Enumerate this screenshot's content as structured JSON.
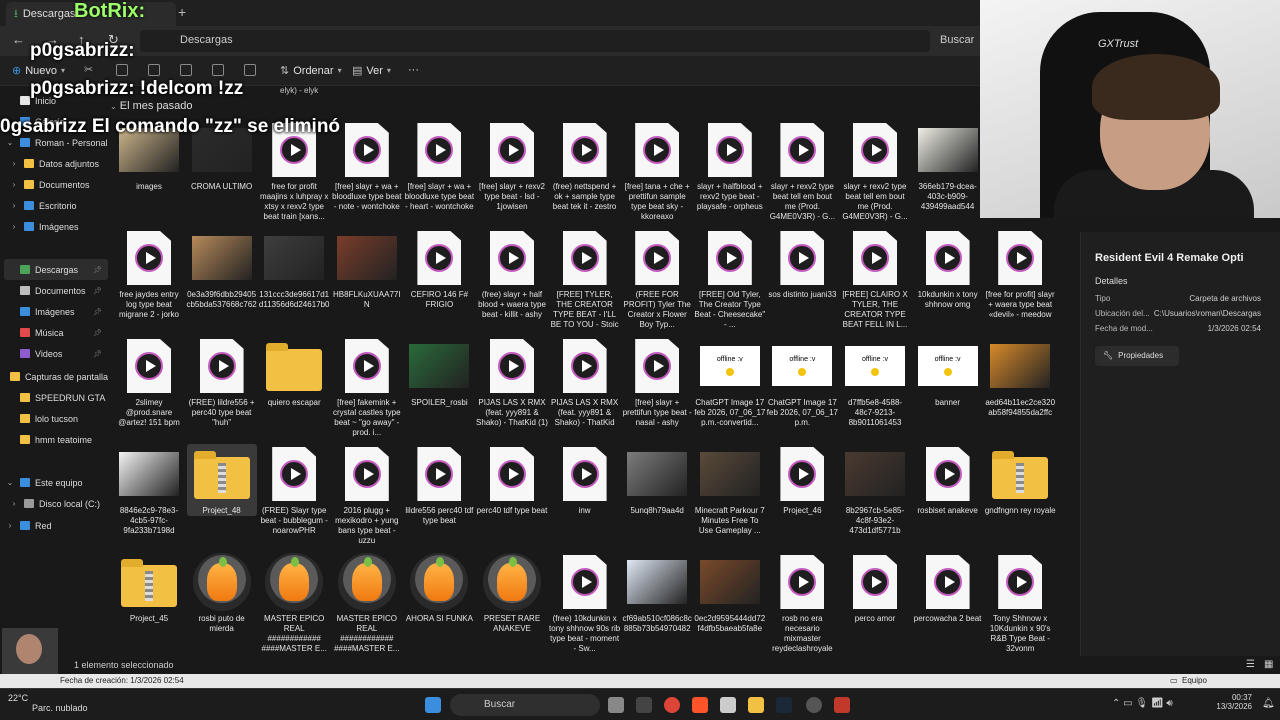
{
  "window": {
    "tab_label": "Descargas",
    "address_label": "Descargas",
    "search_label": "Buscar"
  },
  "toolbar": {
    "new_label": "Nuevo",
    "sort_label": "Ordenar",
    "view_label": "Ver",
    "more_label": "···"
  },
  "sidebar": {
    "items": [
      {
        "label": "Inicio",
        "icon": "home-icon",
        "color": "#e6e6e6"
      },
      {
        "label": "Galería",
        "icon": "gallery-icon",
        "color": "#3b8ede"
      },
      {
        "label": "Roman - Personal",
        "icon": "cloud-icon",
        "color": "#3b8ede"
      },
      {
        "label": "Datos adjuntos",
        "icon": "folder-icon",
        "color": "#f2c144"
      },
      {
        "label": "Documentos",
        "icon": "folder-icon",
        "color": "#f2c144"
      },
      {
        "label": "Escritorio",
        "icon": "folder-icon",
        "color": "#3b8ede"
      },
      {
        "label": "Imágenes",
        "icon": "folder-icon",
        "color": "#3b8ede"
      },
      {
        "label": "Descargas",
        "icon": "download-icon",
        "color": "#4ca35a"
      },
      {
        "label": "Documentos",
        "icon": "document-icon",
        "color": "#bdbdbd"
      },
      {
        "label": "Imágenes",
        "icon": "image-icon",
        "color": "#3b8ede"
      },
      {
        "label": "Música",
        "icon": "music-icon",
        "color": "#e04a4a"
      },
      {
        "label": "Videos",
        "icon": "video-icon",
        "color": "#8e5bd0"
      },
      {
        "label": "Capturas de pantalla",
        "icon": "folder-icon",
        "color": "#f2c144"
      },
      {
        "label": "SPEEDRUN GTA",
        "icon": "folder-icon",
        "color": "#f2c144"
      },
      {
        "label": "lolo tucson",
        "icon": "folder-icon",
        "color": "#f2c144"
      },
      {
        "label": "hmm teatoime",
        "icon": "folder-icon",
        "color": "#f2c144"
      },
      {
        "label": "Este equipo",
        "icon": "computer-icon",
        "color": "#3b8ede"
      },
      {
        "label": "Disco local (C:)",
        "icon": "drive-icon",
        "color": "#9a9a9a"
      },
      {
        "label": "Red",
        "icon": "network-icon",
        "color": "#3b8ede"
      }
    ]
  },
  "main": {
    "group_header": "El mes pasado",
    "partial_top_text": "elyk) - elyk",
    "rows": [
      [
        {
          "type": "image",
          "name": "images",
          "color": "#cbb48a"
        },
        {
          "type": "image",
          "name": "CROMA ULTIMO",
          "color": "#2b2b2b"
        },
        {
          "type": "audio",
          "name": "free for profit maajins x luhpray x xtsy x rexv2 type beat train [xans..."
        },
        {
          "type": "audio",
          "name": "[free] slayr + wa + bloodluxe type beat - note - wontchoke"
        },
        {
          "type": "audio",
          "name": "[free] slayr + wa + bloodluxe type beat - heart - wontchoke"
        },
        {
          "type": "audio",
          "name": "[free] slayr + rexv2 type beat - lsd - 1jowisen"
        },
        {
          "type": "audio",
          "name": "(free) nettspend + ok + sample type beat tek it - zestro"
        },
        {
          "type": "audio",
          "name": "[free] tana + che + prettifun sample type beat sky - kkoreaxo"
        },
        {
          "type": "audio",
          "name": "slayr + halfblood + rexv2 type beat - playsafe - orpheus"
        },
        {
          "type": "audio",
          "name": "slayr + rexv2 type beat tell em bout me (Prod. G4ME0V3R) - G..."
        },
        {
          "type": "audio",
          "name": "slayr + rexv2 type beat tell em bout me (Prod. G4ME0V3R) - G..."
        },
        {
          "type": "image",
          "name": "366eb179-dcea-403c-b909-439499aad544",
          "color": "#efefe6"
        }
      ],
      [
        {
          "type": "audio",
          "name": "free jaydes entry log type beat migrane 2 - jorko"
        },
        {
          "type": "image",
          "name": "0e3a39f6dbb29405cb5bda537668c762",
          "color": "#b78a5a"
        },
        {
          "type": "image",
          "name": "131ccc3de96617d1d11356d6d24617b0",
          "color": "#3e3e3e"
        },
        {
          "type": "image",
          "name": "HB8FLKuXUAA77IN",
          "color": "#7a3d2a"
        },
        {
          "type": "audio",
          "name": "CEFIRO 146 F# FRIGIO"
        },
        {
          "type": "audio",
          "name": "(free) slayr + half blood + waera type beat - killit - ashy"
        },
        {
          "type": "audio",
          "name": "[FREE] TYLER, THE CREATOR TYPE BEAT - I'LL BE TO YOU - Stoic"
        },
        {
          "type": "audio",
          "name": "(FREE FOR PROFIT) Tyler The Creator x Flower Boy Typ..."
        },
        {
          "type": "audio",
          "name": "[FREE] Old Tyler, The Creator Type Beat - Cheesecake\" - ..."
        },
        {
          "type": "audio",
          "name": "sos distinto juani33"
        },
        {
          "type": "audio",
          "name": "[FREE] CLAIRO X TYLER, THE CREATOR TYPE BEAT FELL IN L..."
        },
        {
          "type": "audio",
          "name": "10kdunkin x tony shhnow omg"
        },
        {
          "type": "audio",
          "name": "[free for profit] slayr + waera type beat «devil» - meedow"
        }
      ],
      [
        {
          "type": "audio",
          "name": "2slimey @prod.snare @artez! 151 bpm"
        },
        {
          "type": "audio",
          "name": "(FREE) lildre556 + perc40 type beat \"huh\""
        },
        {
          "type": "folder",
          "name": "quiero escapar"
        },
        {
          "type": "audio",
          "name": "[free] fakemink + crystal castles type beat ~ \"go away\" - prod. i..."
        },
        {
          "type": "image",
          "name": "SPOILER_rosbi",
          "color": "#2a6a3a"
        },
        {
          "type": "audio",
          "name": "PIJAS LAS X RMX (feat. yyy891 & Shako) - ThatKid (1)"
        },
        {
          "type": "audio",
          "name": "PIJAS LAS X RMX (feat. yyy891 & Shako) - ThatKid"
        },
        {
          "type": "audio",
          "name": "[free] slayr + prettifun type beat - nasal - ashy"
        },
        {
          "type": "offline",
          "name": "ChatGPT Image 17 feb 2026, 07_06_17 p.m.-convertid..."
        },
        {
          "type": "offline",
          "name": "ChatGPT Image 17 feb 2026, 07_06_17 p.m."
        },
        {
          "type": "offline",
          "name": "d7ffb5e8-4588-48c7-9213-8b9011061453"
        },
        {
          "type": "offline",
          "name": "banner"
        },
        {
          "type": "image",
          "name": "aed64b11ec2ce320ab58f94855da2ffc",
          "color": "#d88a2a"
        }
      ],
      [
        {
          "type": "image",
          "name": "8846e2c9-78e3-4cb5-97fc-9fa233b7198d",
          "color": "#f3f3f3"
        },
        {
          "type": "zip",
          "name": "Project_48",
          "selected": true
        },
        {
          "type": "audio",
          "name": "(FREE) Slayr type beat - bubblegum - noarowPHR"
        },
        {
          "type": "audio",
          "name": "2016 plugg + mexikodro + yung bans type beat - uzzu"
        },
        {
          "type": "audio",
          "name": "lildre556 perc40 tdf type beat"
        },
        {
          "type": "audio",
          "name": "perc40 tdf type beat"
        },
        {
          "type": "audio",
          "name": "inw"
        },
        {
          "type": "image",
          "name": "5unq8h79aa4d",
          "color": "#7c7c7c"
        },
        {
          "type": "image",
          "name": "Minecraft Parkour 7 Minutes Free To Use Gameplay ...",
          "color": "#5a4a3a"
        },
        {
          "type": "audio",
          "name": "Project_46"
        },
        {
          "type": "image",
          "name": "8b2967cb-5e85-4c8f-93e2-473d1df5771b",
          "color": "#4a3a30"
        },
        {
          "type": "audio",
          "name": "rosbiset anakeve"
        },
        {
          "type": "zip",
          "name": "gndfngnn rey royale"
        }
      ],
      [
        {
          "type": "zip",
          "name": "Project_45"
        },
        {
          "type": "fl",
          "name": "rosbi puto de mierda"
        },
        {
          "type": "fl",
          "name": "MASTER EPICO REAL ############ ####MASTER E..."
        },
        {
          "type": "fl",
          "name": "MASTER EPICO REAL ############ ####MASTER E..."
        },
        {
          "type": "fl",
          "name": "AHORA SI FUNKA"
        },
        {
          "type": "fl",
          "name": "PRESET RARE ANAKEVE"
        },
        {
          "type": "audio",
          "name": "(free) 10kdunkin x tony shhnow 90s rib type beat - moment - Sw..."
        },
        {
          "type": "image",
          "name": "cf69ab510cf086c8c885b73b54970482",
          "color": "#dfe8f5"
        },
        {
          "type": "image",
          "name": "0ec2d9595444dd72f4dfb5baeab5fa8e",
          "color": "#7a4a2a"
        },
        {
          "type": "audio",
          "name": "rosb no era necesario mixmaster reydeclashroyale"
        },
        {
          "type": "audio",
          "name": "perco amor"
        },
        {
          "type": "audio",
          "name": "percowacha 2 beat"
        },
        {
          "type": "audio",
          "name": "Tony Shhnow x 10Kdunkin x 90's R&B Type Beat - 32vonm"
        }
      ]
    ]
  },
  "details": {
    "title": "Resident Evil 4 Remake Opti",
    "section": "Detalles",
    "rows": [
      {
        "label": "Tipo",
        "value": "Carpeta de archivos"
      },
      {
        "label": "Ubicación del...",
        "value": "C:\\Usuarios\\roman\\Descargas"
      },
      {
        "label": "Fecha de mod...",
        "value": "1/3/2026 02:54"
      }
    ],
    "properties_label": "Propiedades"
  },
  "status": {
    "selection_text": "1 elemento seleccionado",
    "bottom_info": "Fecha de creación: 1/3/2026 02:54",
    "network_label": "Equipo"
  },
  "taskbar": {
    "search_label": "Buscar",
    "weather_temp": "22°C",
    "weather_desc": "Parc. nublado",
    "time": "00:37",
    "date": "13/3/2026"
  },
  "overlay": {
    "botrix": "BotRix:",
    "chat": [
      "p0gsabrizz:",
      "p0gsabrizz: !delcom !zz",
      "0gsabrizz El comando \"zz\" se eliminó"
    ],
    "chair_brand": "GXTrust"
  }
}
